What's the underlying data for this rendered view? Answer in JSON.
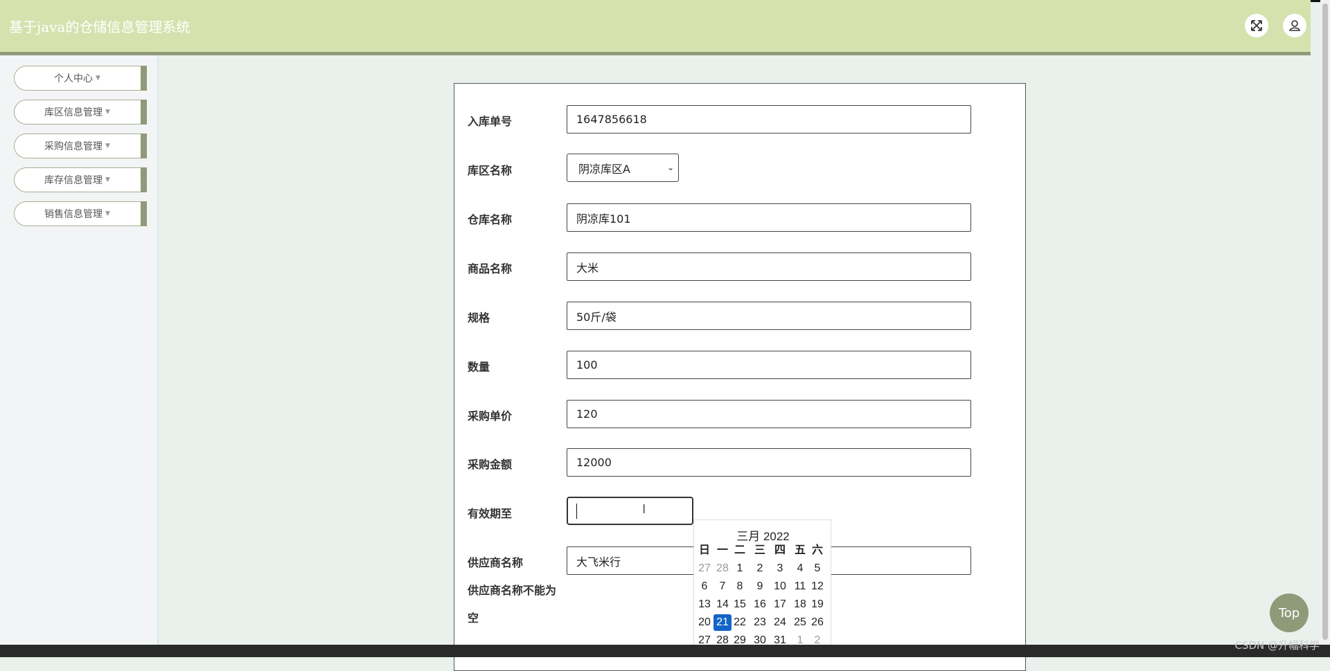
{
  "header": {
    "title": "基于java的仓储信息管理系统",
    "fullscreen_icon": "expand-arrows-icon",
    "user_icon": "user-icon"
  },
  "sidebar": {
    "items": [
      {
        "label": "个人中心"
      },
      {
        "label": "库区信息管理"
      },
      {
        "label": "采购信息管理"
      },
      {
        "label": "库存信息管理"
      },
      {
        "label": "销售信息管理"
      }
    ]
  },
  "form": {
    "fields": [
      {
        "label": "入库单号",
        "value": "1647856618"
      },
      {
        "label": "库区名称",
        "value": "阴凉库区A"
      },
      {
        "label": "仓库名称",
        "value": "阴凉库101"
      },
      {
        "label": "商品名称",
        "value": "大米"
      },
      {
        "label": "规格",
        "value": "50斤/袋"
      },
      {
        "label": "数量",
        "value": "100"
      },
      {
        "label": "采购单价",
        "value": "120"
      },
      {
        "label": "采购金额",
        "value": "12000"
      },
      {
        "label": "有效期至",
        "value": ""
      },
      {
        "label": "供应商名称",
        "value": "大飞米行"
      }
    ],
    "error_line1": "供应商名称不能为",
    "error_line2": "空"
  },
  "calendar": {
    "title": "三月 2022",
    "weekdays": [
      "日",
      "一",
      "二",
      "三",
      "四",
      "五",
      "六"
    ],
    "selected_day": "21",
    "weeks": [
      [
        "27",
        "28",
        "1",
        "2",
        "3",
        "4",
        "5"
      ],
      [
        "6",
        "7",
        "8",
        "9",
        "10",
        "11",
        "12"
      ],
      [
        "13",
        "14",
        "15",
        "16",
        "17",
        "18",
        "19"
      ],
      [
        "20",
        "21",
        "22",
        "23",
        "24",
        "25",
        "26"
      ],
      [
        "27",
        "28",
        "29",
        "30",
        "31",
        "1",
        "2"
      ]
    ]
  },
  "top_button": "Top",
  "watermark": "CSDN @升幅科学",
  "colors": {
    "header_bg": "#d5e2ae",
    "accent": "#8f9a78",
    "selected_day": "#1464c8"
  }
}
